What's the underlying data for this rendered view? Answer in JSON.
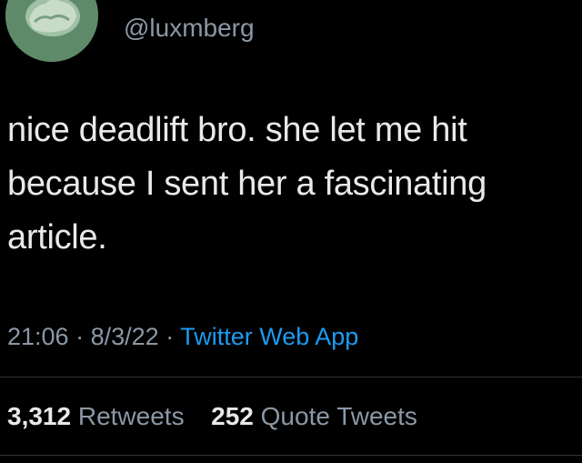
{
  "user": {
    "handle": "@luxmberg",
    "avatar_color": "#5f8a6a"
  },
  "tweet": {
    "text": "nice deadlift bro. she let me hit because I sent her a fascinating article.",
    "time": "21:06",
    "separator": "·",
    "date": "8/3/22",
    "source": "Twitter Web App"
  },
  "stats": {
    "retweets_count": "3,312",
    "retweets_label": "Retweets",
    "quotes_count": "252",
    "quotes_label": "Quote Tweets"
  },
  "colors": {
    "background": "#000000",
    "primary_text": "#e7e9ea",
    "secondary_text": "#8b98a5",
    "link": "#1d9bf0",
    "divider": "#2f3336"
  }
}
